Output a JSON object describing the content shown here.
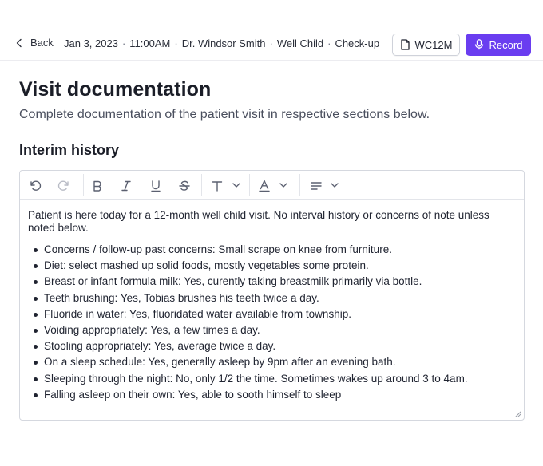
{
  "header": {
    "back_label": "Back",
    "breadcrumbs": [
      "Jan 3, 2023",
      "11:00AM",
      "Dr. Windsor Smith",
      "Well Child",
      "Check-up"
    ],
    "separator": "·",
    "code_button_label": "WC12M",
    "record_button_label": "Record"
  },
  "page": {
    "title": "Visit documentation",
    "subtitle": "Complete documentation of the patient visit in respective sections below."
  },
  "section": {
    "title": "Interim history"
  },
  "toolbar": {
    "icons": [
      "undo-icon",
      "redo-icon",
      "bold-icon",
      "italic-icon",
      "underline-icon",
      "strikethrough-icon",
      "text-style-icon",
      "text-color-icon",
      "align-icon"
    ]
  },
  "editor": {
    "intro": "Patient is here today for a 12-month well child visit. No interval history or concerns of note unless noted below.",
    "items": [
      "Concerns / follow-up past concerns: Small scrape on knee from furniture.",
      "Diet: select mashed up solid foods, mostly vegetables some protein.",
      "Breast or infant formula milk: Yes, curently taking breastmilk primarily via bottle.",
      "Teeth brushing: Yes, Tobias brushes his teeth twice a day.",
      "Fluoride in water: Yes, fluoridated water available from township.",
      "Voiding appropriately: Yes, a few times a day.",
      "Stooling appropriately: Yes, average twice a day.",
      "On a sleep schedule: Yes, generally asleep by 9pm after an evening bath.",
      "Sleeping through the night: No, only 1/2 the time. Sometimes wakes up around 3 to 4am.",
      "Falling asleep on their own: Yes, able to sooth himself to sleep"
    ]
  },
  "colors": {
    "accent": "#6a3df0",
    "text": "#1f2330",
    "muted": "#4a4f5e",
    "border": "#d5d8df"
  }
}
